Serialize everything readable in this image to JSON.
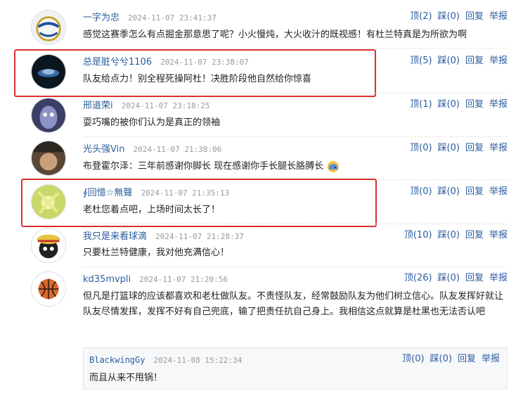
{
  "comments": [
    {
      "user": "一字为忠",
      "time": "2024-11-07 23:41:37",
      "up": "顶(2)",
      "down": "踩(0)",
      "reply": "回复",
      "report": "举报",
      "text": "感觉这赛季怎么有点掘金那意思了呢？小火慢炖，大火收汁的既视感！有杜兰特真是为所欲为啊"
    },
    {
      "user": "总是脏兮兮1106",
      "time": "2024-11-07 23:38:07",
      "up": "顶(5)",
      "down": "踩(0)",
      "reply": "回复",
      "report": "举报",
      "text": "队友给点力！别全程死操阿杜！决胜阶段他自然给你惊喜"
    },
    {
      "user": "邢道荣i",
      "time": "2024-11-07 23:18:25",
      "up": "顶(1)",
      "down": "踩(0)",
      "reply": "回复",
      "report": "举报",
      "text": "耍巧嘴的被你们认为是真正的领袖"
    },
    {
      "user": "光头强Vin",
      "time": "2024-11-07 21:38:06",
      "up": "顶(0)",
      "down": "踩(0)",
      "reply": "回复",
      "report": "举报",
      "text": "布登霍尔泽：三年前感谢你脚长 现在感谢你手长腿长胳膊长"
    },
    {
      "user": "∮回憶☆無聲",
      "time": "2024-11-07 21:35:13",
      "up": "顶(0)",
      "down": "踩(0)",
      "reply": "回复",
      "report": "举报",
      "text": "老杜您着点吧，上场时间太长了！"
    },
    {
      "user": "我只是来看球滴",
      "time": "2024-11-07 21:28:37",
      "up": "顶(10)",
      "down": "踩(0)",
      "reply": "回复",
      "report": "举报",
      "text": "只要杜兰特健康，我对他充满信心！"
    },
    {
      "user": "kd35mvpli",
      "time": "2024-11-07 21:20:56",
      "up": "顶(26)",
      "down": "踩(0)",
      "reply": "回复",
      "report": "举报",
      "text": "但凡是打篮球的应该都喜欢和老杜做队友。不责怪队友，经常鼓励队友为他们树立信心。队友发挥好就让队友尽情发挥，发挥不好有自己兜底，输了把责任抗自己身上。我相信这点就算是杜黑也无法否认吧"
    }
  ],
  "nested_reply": {
    "user": "BlackwingGy",
    "time": "2024-11-08 15:22:34",
    "up": "顶(0)",
    "down": "踩(0)",
    "reply": "回复",
    "report": "举报",
    "text": "而且从来不甩锅！"
  },
  "emoji_icon": "facepalm-emoji-icon",
  "colors": {
    "link": "#2a5d9f",
    "highlight": "#d9302f",
    "time": "#999999"
  }
}
